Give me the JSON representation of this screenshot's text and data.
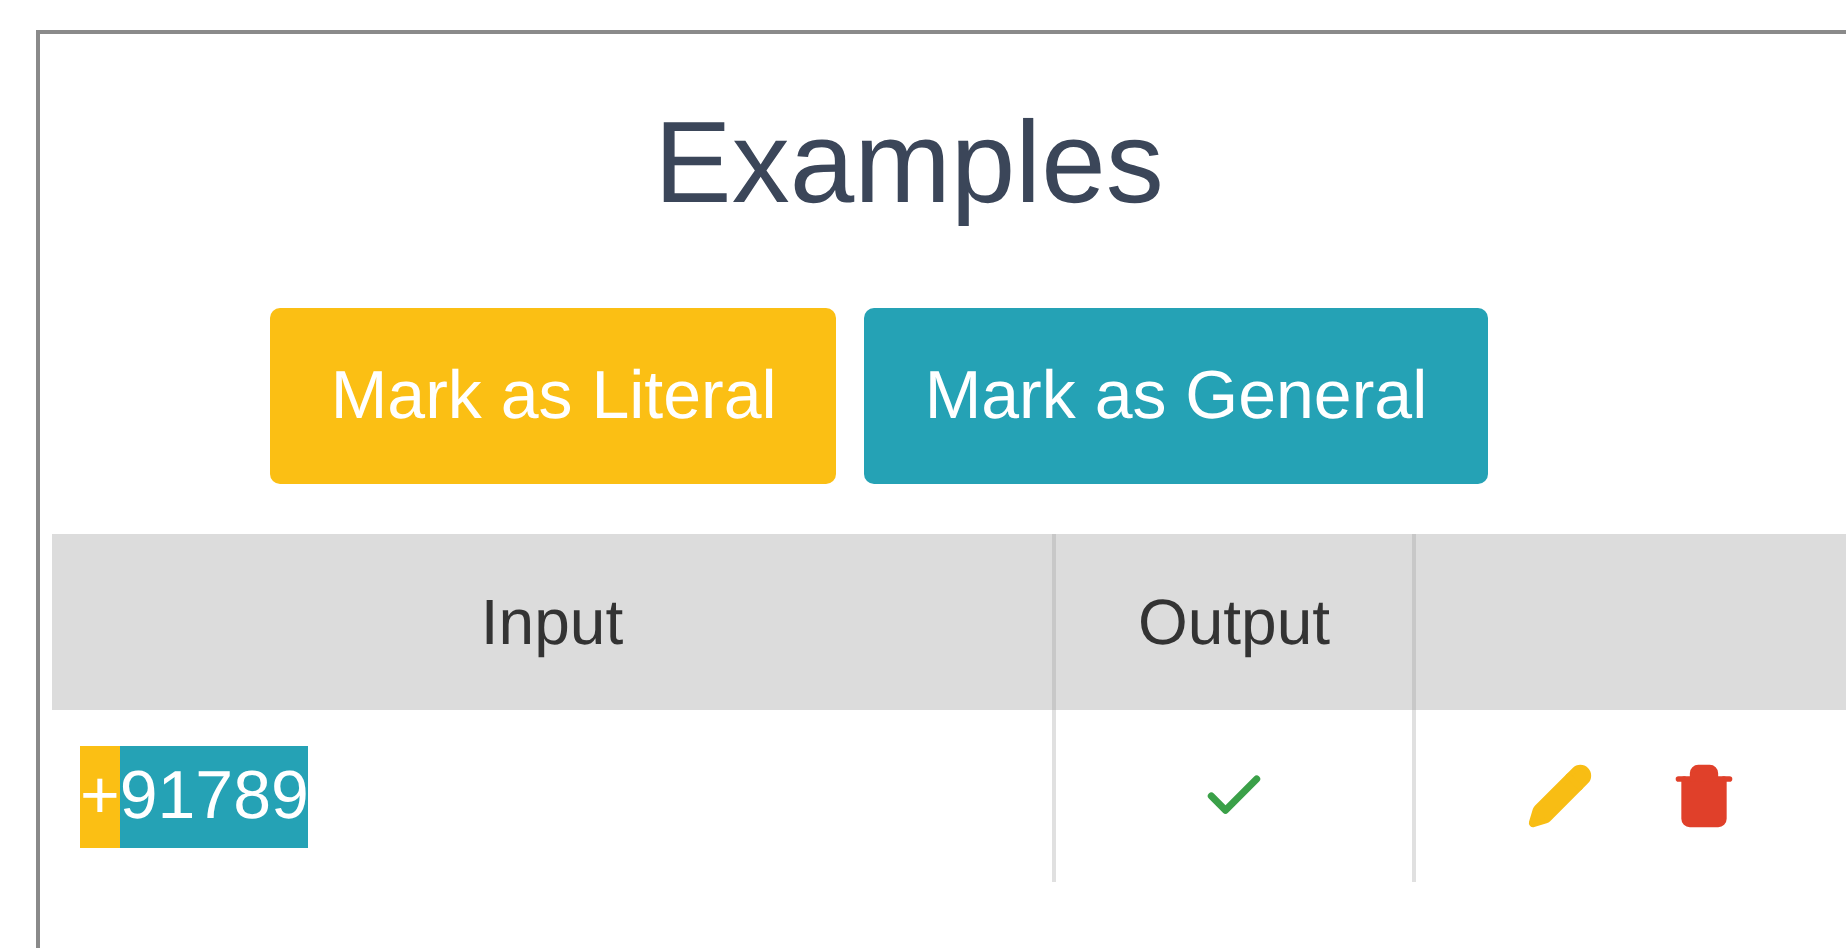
{
  "title": "Examples",
  "buttons": [
    {
      "label": "Mark as Literal",
      "kind": "literal"
    },
    {
      "label": "Mark as General",
      "kind": "general"
    }
  ],
  "table": {
    "columns": [
      "Input",
      "Output"
    ],
    "rows": [
      {
        "input": [
          {
            "text": "+",
            "kind": "literal"
          },
          {
            "text": "91789",
            "kind": "general"
          }
        ],
        "output_ok": true
      }
    ]
  }
}
